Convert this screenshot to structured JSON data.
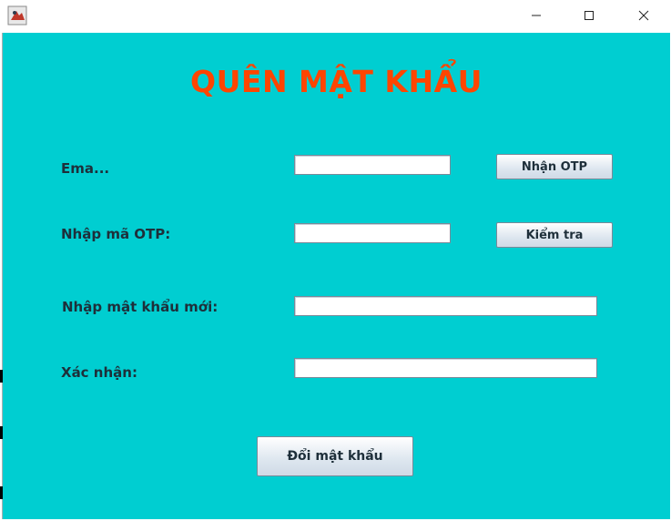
{
  "window": {
    "minimize_glyph": "—",
    "maximize_glyph": "☐",
    "close_glyph": "✕"
  },
  "form": {
    "title": "QUÊN MẬT KHẨU",
    "email_label": "Ema...",
    "email_value": "",
    "otp_label": "Nhập mã OTP:",
    "otp_value": "",
    "new_password_label": "Nhập mật khẩu mới:",
    "new_password_value": "",
    "confirm_label": "Xác nhận:",
    "confirm_value": "",
    "get_otp_button": "Nhận OTP",
    "check_button": "Kiểm tra",
    "change_password_button": "Đổi mật khẩu"
  },
  "colors": {
    "background": "#00ced1",
    "title": "#ff4500",
    "label": "#1e2f3a"
  }
}
